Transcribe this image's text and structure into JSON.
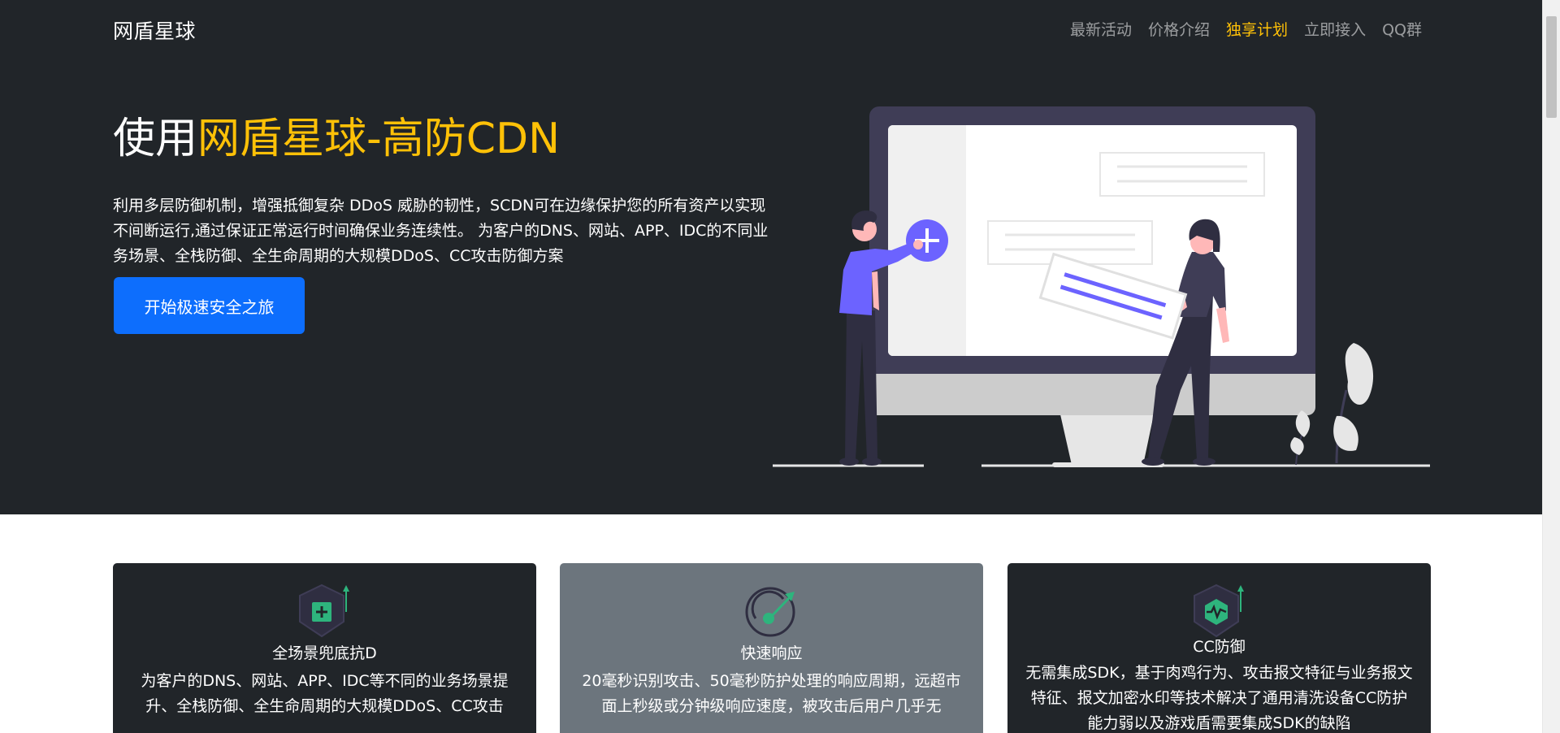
{
  "navbar": {
    "brand": "网盾星球",
    "links": [
      {
        "label": "最新活动"
      },
      {
        "label": "价格介绍"
      },
      {
        "label": "独享计划"
      },
      {
        "label": "立即接入"
      },
      {
        "label": "QQ群"
      }
    ],
    "active_index": 2
  },
  "hero": {
    "title_prefix": "使用",
    "title_highlight": "网盾星球-高防CDN",
    "description": "利用多层防御机制，增强抵御复杂 DDoS 威胁的韧性，SCDN可在边缘保护您的所有资产以实现不间断运行,通过保证正常运行时间确保业务连续性。 为客户的DNS、网站、APP、IDC的不同业务场景、全栈防御、全生命周期的大规模DDoS、CC攻击防御方案",
    "cta_label": "开始极速安全之旅"
  },
  "features": [
    {
      "icon": "shield-plus-icon",
      "title": "全场景兜底抗D",
      "text": "为客户的DNS、网站、APP、IDC等不同的业务场景提升、全栈防御、全生命周期的大规模DDoS、CC攻击"
    },
    {
      "icon": "speedometer-icon",
      "title": "快速响应",
      "text": "20毫秒识别攻击、50毫秒防护处理的响应周期，远超市面上秒级或分钟级响应速度，被攻击后用户几乎无"
    },
    {
      "icon": "shield-pulse-icon",
      "title": "CC防御",
      "text": "无需集成SDK，基于肉鸡行为、攻击报文特征与业务报文特征、报文加密水印等技术解决了通用清洗设备CC防护能力弱以及游戏盾需要集成SDK的缺陷"
    }
  ],
  "colors": {
    "hero_bg": "#212529",
    "accent": "#ffc107",
    "primary": "#0d6efd",
    "card_gray": "#6c757d",
    "illustration_purple": "#6c63ff",
    "feature_green": "#2eb47d"
  }
}
